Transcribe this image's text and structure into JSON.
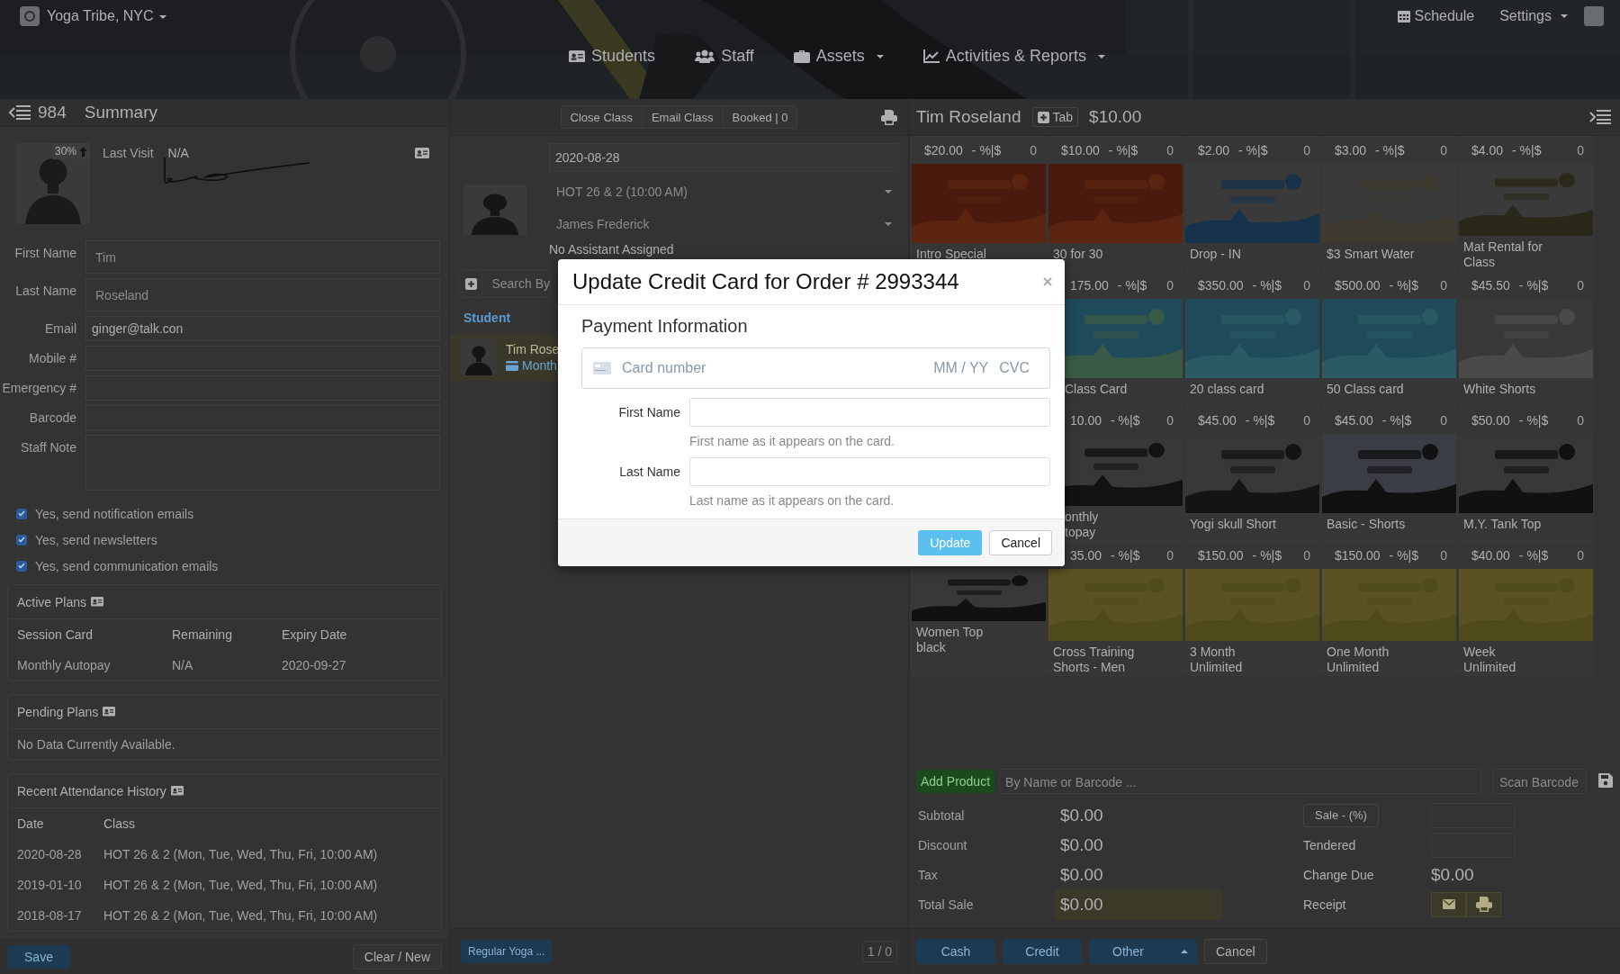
{
  "header": {
    "location": "Yoga Tribe, NYC",
    "nav": [
      {
        "label": "Students",
        "dropdown": false
      },
      {
        "label": "Staff",
        "dropdown": false
      },
      {
        "label": "Assets",
        "dropdown": true
      },
      {
        "label": "Activities & Reports",
        "dropdown": true
      }
    ],
    "schedule": "Schedule",
    "settings": "Settings"
  },
  "student": {
    "record_number": "984",
    "title": "Summary",
    "photo_badge": "30%",
    "last_visit_label": "Last Visit",
    "last_visit": "N/A",
    "fields": [
      {
        "kind": "input",
        "label": "First Name",
        "placeholder": "Tim"
      },
      {
        "kind": "input",
        "label": "Last Name",
        "placeholder": "Roseland"
      },
      {
        "kind": "input",
        "label": "Email",
        "value": "ginger@talk.con"
      },
      {
        "kind": "input",
        "label": "Mobile #"
      },
      {
        "kind": "input",
        "label": "Emergency #"
      },
      {
        "kind": "input",
        "label": "Barcode"
      },
      {
        "kind": "textarea",
        "label": "Staff Note"
      }
    ],
    "checkboxes": [
      {
        "label": "Yes, send notification emails",
        "checked": true
      },
      {
        "label": "Yes, send newsletters",
        "checked": true
      },
      {
        "label": "Yes, send communication emails",
        "checked": true
      }
    ],
    "active_plans": {
      "title": "Active Plans",
      "columns": [
        "Session Card",
        "Remaining",
        "Expiry Date"
      ],
      "rows": [
        [
          "Monthly Autopay",
          "N/A",
          "2020-09-27"
        ]
      ]
    },
    "pending_plans": {
      "title": "Pending Plans",
      "empty_text": "No Data Currently Available."
    },
    "attendance": {
      "title": "Recent Attendance History",
      "columns": [
        "Date",
        "Class"
      ],
      "rows": [
        [
          "2020-08-28",
          "HOT 26 & 2 (Mon, Tue, Wed, Thu, Fri, 10:00 AM)"
        ],
        [
          "2019-01-10",
          "HOT 26 & 2 (Mon, Tue, Wed, Thu, Fri, 10:00 AM)"
        ],
        [
          "2018-08-17",
          "HOT 26 & 2 (Mon, Tue, Wed, Thu, Fri, 10:00 AM)"
        ]
      ]
    },
    "save_button": "Save",
    "clear_button": "Clear / New"
  },
  "class": {
    "actions": [
      "Close Class",
      "Email Class",
      "Booked | 0"
    ],
    "date": "2020-08-28",
    "class_select": "HOT 26 & 2 (10:00 AM)",
    "instructor_select": "James Frederick",
    "assistant": "No Assistant Assigned",
    "search_placeholder": "Search By",
    "list_heading": "Student",
    "students": [
      {
        "name": "Tim Rose",
        "plan": "Month"
      }
    ],
    "class_button": "Regular Yoga ...",
    "count": "1 / 0"
  },
  "pos": {
    "customer": "Tim Roseland",
    "tab_label": "Tab",
    "balance": "$10.00",
    "products": [
      [
        {
          "kind": "item",
          "price": "$20.00",
          "discount": "- %|$",
          "qty": "0",
          "label": "Intro Special"
        },
        {
          "kind": "item",
          "price": "$10.00",
          "discount": "- %|$",
          "qty": "0",
          "label": "30 for 30"
        },
        {
          "kind": "item",
          "price": "$2.00",
          "discount": "- %|$",
          "qty": "0",
          "label": "Drop - IN"
        },
        {
          "kind": "item",
          "price": "$3.00",
          "discount": "- %|$",
          "qty": "0",
          "label": "$3 Smart Water"
        },
        {
          "kind": "item",
          "price": "$4.00",
          "discount": "- %|$",
          "qty": "0",
          "label": "Mat Rental for\nClass"
        }
      ],
      [
        {
          "kind": "item",
          "price": "175.00",
          "discount": "- %|$",
          "qty": "0",
          "label": "Class Card"
        },
        {
          "kind": "item",
          "price": "$350.00",
          "discount": "- %|$",
          "qty": "0",
          "label": "20 class card"
        },
        {
          "kind": "item",
          "price": "$500.00",
          "discount": "- %|$",
          "qty": "0",
          "label": "50 Class card"
        },
        {
          "kind": "item",
          "price": "$45.50",
          "discount": "- %|$",
          "qty": "0",
          "label": "White Shorts"
        }
      ],
      [
        {
          "kind": "item",
          "price": "10.00",
          "discount": "- %|$",
          "qty": "0",
          "label": "onthly\ntopay"
        },
        {
          "kind": "item",
          "price": "$45.00",
          "discount": "- %|$",
          "qty": "0",
          "label": "Yogi skull Short"
        },
        {
          "kind": "item",
          "price": "$45.00",
          "discount": "- %|$",
          "qty": "0",
          "label": "Basic - Shorts"
        },
        {
          "kind": "item",
          "price": "$50.00",
          "discount": "- %|$",
          "qty": "0",
          "label": "M.Y. Tank Top"
        }
      ],
      [
        {
          "kind": "item",
          "label": "Women Top\nblack"
        },
        {
          "kind": "item",
          "price": "35.00",
          "discount": "- %|$",
          "qty": "0",
          "label": "Cross Training\nShorts - Men"
        },
        {
          "kind": "item",
          "price": "$150.00",
          "discount": "- %|$",
          "qty": "0",
          "label": "3 Month\nUnlimited"
        },
        {
          "kind": "item",
          "price": "$150.00",
          "discount": "- %|$",
          "qty": "0",
          "label": "One Month\nUnlimited"
        },
        {
          "kind": "item",
          "price": "$40.00",
          "discount": "- %|$",
          "qty": "0",
          "label": "Week\nUnlimited"
        }
      ]
    ],
    "add_product": "Add Product",
    "product_search_placeholder": "By Name or Barcode ...",
    "scan_placeholder": "Scan Barcode",
    "totals": [
      {
        "label": "Subtotal",
        "value": "$0.00",
        "highlighted": false
      },
      {
        "label": "Discount",
        "value": "$0.00",
        "highlighted": false
      },
      {
        "label": "Tax",
        "value": "$0.00",
        "highlighted": false
      },
      {
        "label": "Total Sale",
        "value": "$0.00",
        "highlighted": true
      }
    ],
    "sale_button": "Sale - (%)",
    "tendered_label": "Tendered",
    "change_due_label": "Change Due",
    "change_due": "$0.00",
    "receipt_label": "Receipt",
    "payment_buttons": [
      "Cash",
      "Credit",
      "Other"
    ],
    "cancel_button": "Cancel"
  },
  "modal": {
    "title": "Update Credit Card for Order # 2993344",
    "section": "Payment Information",
    "card_placeholder": "Card number",
    "expiry_placeholder": "MM / YY",
    "cvc_placeholder": "CVC",
    "fields": [
      {
        "label": "First Name",
        "help": "First name as it appears on the card."
      },
      {
        "label": "Last Name",
        "help": "Last name as it appears on the card."
      }
    ],
    "update_button": "Update",
    "cancel_button": "Cancel"
  }
}
